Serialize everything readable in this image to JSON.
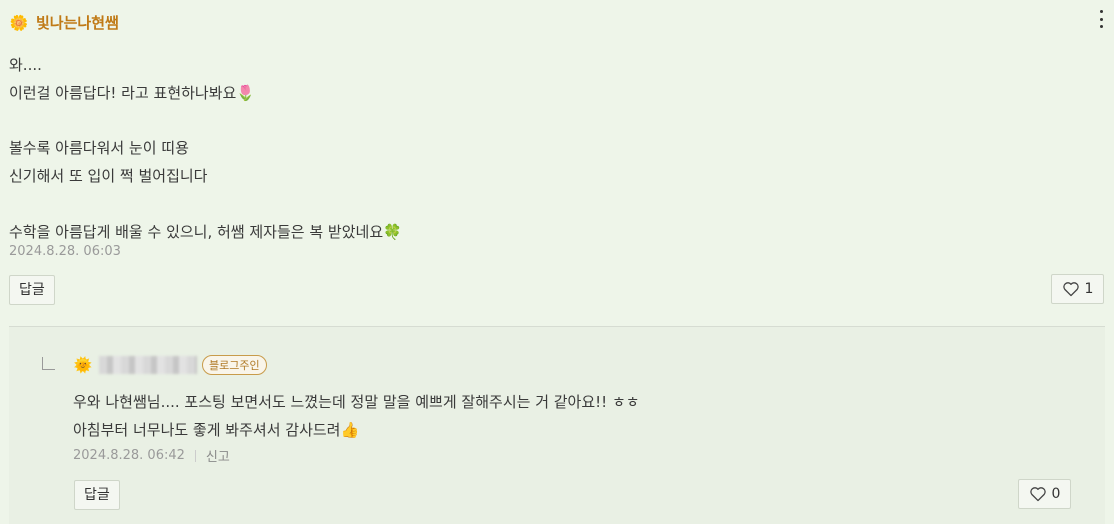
{
  "comment": {
    "author": "빛나는나현쌤",
    "avatar_icon": "flower-icon",
    "lines": [
      "와....",
      "이런걸 아름답다! 라고 표현하나봐요🌷",
      "",
      "볼수록 아름다워서 눈이 띠용",
      "신기해서 또 입이 쩍 벌어집니다",
      "",
      "수학을 아름답게 배울 수 있으니, 허쌤 제자들은 복 받았네요🍀"
    ],
    "date": "2024.8.28. 06:03",
    "reply_label": "답글",
    "like_count": "1"
  },
  "reply": {
    "author_blurred": true,
    "avatar_icon": "sun-icon",
    "badge": "블로그주인",
    "lines": [
      "우와 나현쌤님.... 포스팅 보면서도 느꼈는데 정말 말을 예쁘게 잘해주시는 거 같아요!! ㅎㅎ",
      "아침부터 너무나도 좋게 봐주셔서 감사드려👍"
    ],
    "date": "2024.8.28. 06:42",
    "report_label": "신고",
    "reply_label": "답글",
    "like_count": "0"
  }
}
